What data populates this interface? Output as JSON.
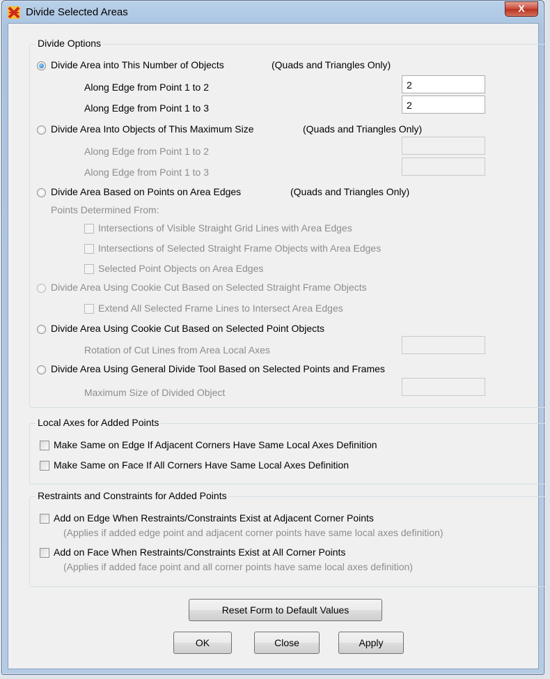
{
  "window": {
    "title": "Divide Selected Areas",
    "close_glyph": "X"
  },
  "divide_options": {
    "legend": "Divide Options",
    "opt1": {
      "label": "Divide Area into This Number of Objects",
      "note": "(Quads and Triangles Only)",
      "edge12_label": "Along Edge from Point 1 to 2",
      "edge12_value": "2",
      "edge13_label": "Along Edge from Point 1 to 3",
      "edge13_value": "2"
    },
    "opt2": {
      "label": "Divide Area Into Objects of This Maximum Size",
      "note": "(Quads and Triangles Only)",
      "edge12_label": "Along Edge from Point 1 to 2",
      "edge13_label": "Along Edge from Point 1 to 3"
    },
    "opt3": {
      "label": "Divide Area Based on Points on Area Edges",
      "note": "(Quads and Triangles Only)",
      "points_from": "Points Determined From:",
      "cb1": "Intersections of Visible Straight Grid Lines with Area Edges",
      "cb2": "Intersections of Selected Straight Frame Objects with Area Edges",
      "cb3": "Selected Point Objects on Area Edges"
    },
    "opt4": {
      "label": "Divide Area Using Cookie Cut Based on Selected Straight Frame Objects",
      "cb": "Extend All Selected Frame Lines to Intersect Area Edges"
    },
    "opt5": {
      "label": "Divide Area Using Cookie Cut Based on Selected Point Objects",
      "rotation_label": "Rotation of Cut Lines from Area Local Axes"
    },
    "opt6": {
      "label": "Divide Area Using General Divide Tool Based on Selected Points and Frames",
      "max_size_label": "Maximum Size of Divided Object"
    }
  },
  "local_axes": {
    "legend": "Local Axes for Added Points",
    "cb1": "Make Same on Edge If Adjacent Corners Have Same Local Axes Definition",
    "cb2": "Make Same on Face If All Corners Have Same Local Axes Definition"
  },
  "restraints": {
    "legend": "Restraints and Constraints for Added Points",
    "cb1": "Add on Edge When Restraints/Constraints Exist at Adjacent Corner Points",
    "cb1_note": "(Applies if added edge point and adjacent corner points have same local axes definition)",
    "cb2": "Add on Face When Restraints/Constraints Exist at All Corner Points",
    "cb2_note": "(Applies if added face point and all corner points have same local axes definition)"
  },
  "buttons": {
    "reset": "Reset Form to Default Values",
    "ok": "OK",
    "close": "Close",
    "apply": "Apply"
  },
  "colors": {
    "accent_radio": "#1f6fc4",
    "disabled_text": "#8d8d8d",
    "close_button": "#c7483a"
  }
}
